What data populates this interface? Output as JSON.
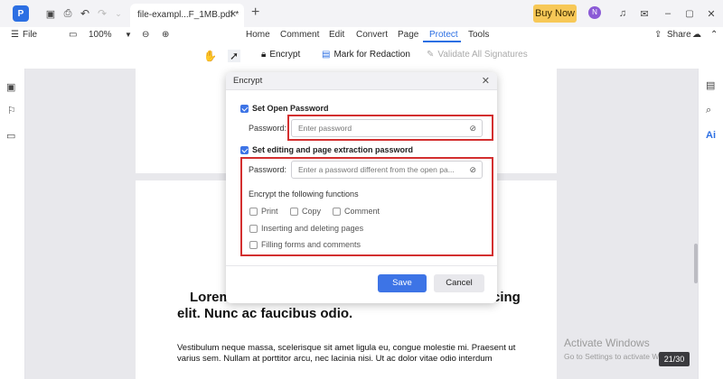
{
  "titlebar": {
    "tab_label": "file-exampl...F_1MB.pdf *",
    "buy_now": "Buy Now",
    "avatar_initial": "N"
  },
  "menubar": {
    "file": "File",
    "zoom": "100%",
    "tabs": [
      "Home",
      "Comment",
      "Edit",
      "Convert",
      "Page",
      "Protect",
      "Tools"
    ],
    "active_tab": "Protect",
    "share": "Share"
  },
  "toolbar": {
    "encrypt": "Encrypt",
    "mark_for_redaction": "Mark for Redaction",
    "validate_signatures": "Validate All Signatures"
  },
  "dialog": {
    "title": "Encrypt",
    "open_password_label": "Set Open Password",
    "password_label": "Password:",
    "open_password_placeholder": "Enter password",
    "edit_password_label": "Set editing and page extraction password",
    "edit_password_placeholder": "Enter a password different from the open pa...",
    "encrypt_functions_label": "Encrypt the following functions",
    "print": "Print",
    "copy": "Copy",
    "comment": "Comment",
    "inserting": "Inserting and deleting pages",
    "filling": "Filling forms and comments",
    "save": "Save",
    "cancel": "Cancel"
  },
  "document": {
    "heading_line1_start": "Lorem",
    "heading_line1_end": "cing",
    "heading_line2": "elit. Nunc ac faucibus odio.",
    "body_line1": "Vestibulum neque massa, scelerisque sit amet ligula eu, congue molestie mi. Praesent ut",
    "body_line2": "varius sem. Nullam at porttitor arcu, nec lacinia nisi. Ut ac dolor vitae odio interdum"
  },
  "status": {
    "watermark_title": "Activate Windows",
    "watermark_sub": "Go to Settings to activate Windows.",
    "page_indicator": "21/30"
  },
  "colors": {
    "accent": "#3d74e6",
    "highlight": "#d32f2f",
    "buy_now": "#f7c857"
  }
}
